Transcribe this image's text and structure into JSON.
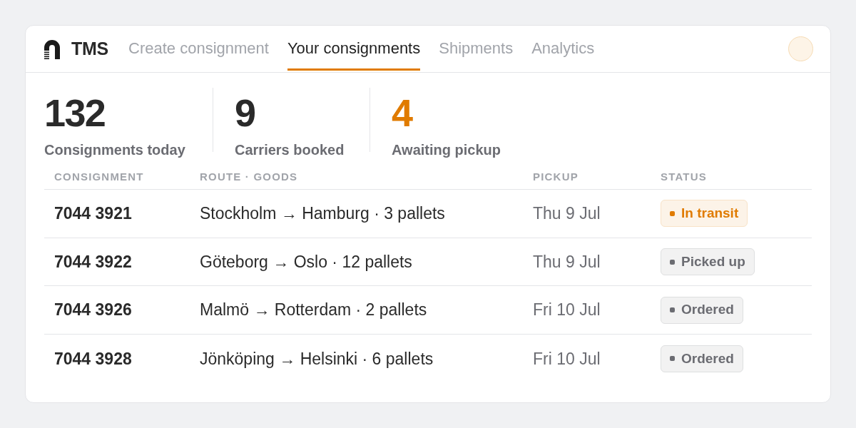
{
  "app": {
    "name": "TMS"
  },
  "tabs": [
    {
      "label": "Create consignment",
      "selected": false
    },
    {
      "label": "Your consignments",
      "selected": true
    },
    {
      "label": "Shipments",
      "selected": false
    },
    {
      "label": "Analytics",
      "selected": false
    }
  ],
  "stats": [
    {
      "value": "132",
      "label": "Consignments today",
      "highlighted": false
    },
    {
      "value": "9",
      "label": "Carriers booked",
      "highlighted": false
    },
    {
      "value": "4",
      "label": "Awaiting pickup",
      "highlighted": true
    }
  ],
  "table": {
    "columns": [
      "CONSIGNMENT",
      "ROUTE · GOODS",
      "PICKUP",
      "STATUS"
    ],
    "rows": [
      {
        "consignment": "7044 3921",
        "route": "Stockholm → Hamburg · 3 pallets",
        "pickup": "Thu 9 Jul",
        "status": {
          "label": "In transit",
          "color": "#e07b00"
        }
      },
      {
        "consignment": "7044 3922",
        "route": "Göteborg → Oslo · 12 pallets",
        "pickup": "Thu 9 Jul",
        "status": {
          "label": "Picked up",
          "color": "#6b6c72"
        }
      },
      {
        "consignment": "7044 3926",
        "route": "Malmö → Rotterdam · 2 pallets",
        "pickup": "Fri 10 Jul",
        "status": {
          "label": "Ordered",
          "color": "#6b6c72"
        }
      },
      {
        "consignment": "7044 3928",
        "route": "Jönköping → Helsinki · 6 pallets",
        "pickup": "Fri 10 Jul",
        "status": {
          "label": "Ordered",
          "color": "#6b6c72"
        }
      }
    ]
  }
}
